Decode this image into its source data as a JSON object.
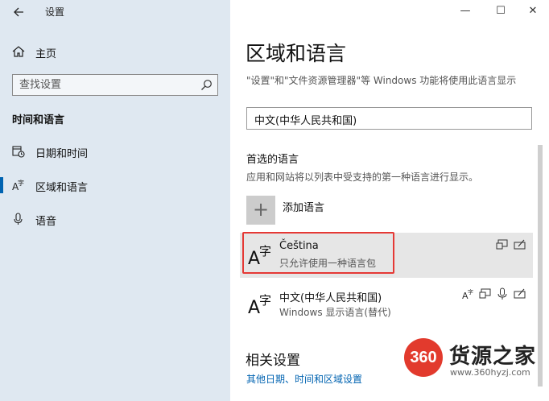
{
  "app": {
    "title": "设置",
    "home_label": "主页",
    "search_placeholder": "查找设置",
    "section_title": "时间和语言"
  },
  "nav": {
    "date_time": "日期和时间",
    "region_language": "区域和语言",
    "speech": "语音"
  },
  "window_controls": {
    "minimize": "—",
    "maximize": "☐",
    "close": "✕"
  },
  "main": {
    "title": "区域和语言",
    "description": "\"设置\"和\"文件资源管理器\"等 Windows 功能将使用此语言显示",
    "region_value": "中文(中华人民共和国)",
    "preferred_heading": "首选的语言",
    "preferred_desc": "应用和网站将以列表中受支持的第一种语言进行显示。",
    "add_language_label": "添加语言",
    "add_language_symbol": "+",
    "languages": [
      {
        "name": "Čeština",
        "sub": "只允许使用一种语言包"
      },
      {
        "name": "中文(中华人民共和国)",
        "sub": "Windows 显示语言(替代)"
      }
    ],
    "related_heading": "相关设置",
    "related_link": "其他日期、时间和区域设置"
  },
  "watermark": {
    "badge": "360",
    "name": "货源之家",
    "url": "www.360hyzj.com"
  },
  "colors": {
    "accent": "#0063b1",
    "sidebar_bg": "#dfe8f1",
    "highlight": "#e53935"
  }
}
